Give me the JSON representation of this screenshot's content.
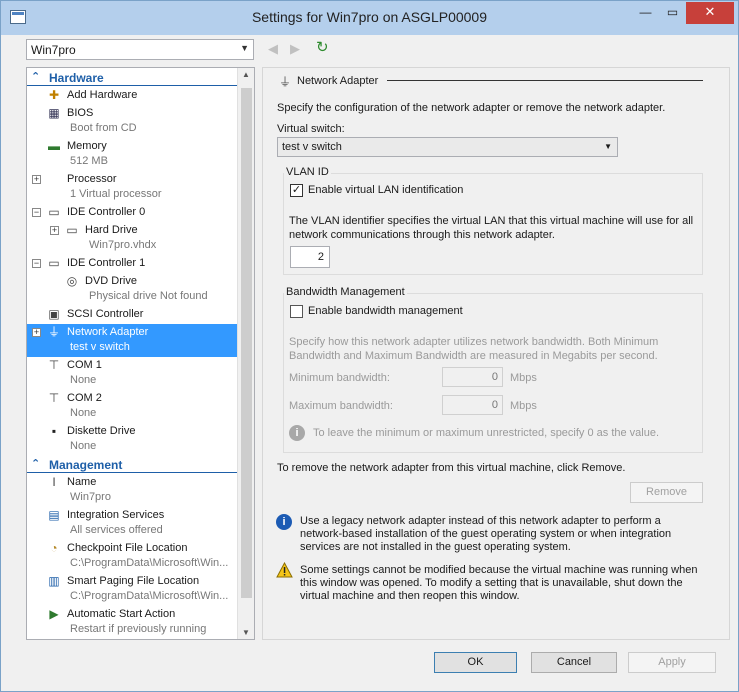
{
  "window": {
    "title": "Settings for Win7pro on ASGLP00009",
    "minimize": "—",
    "maximize": "▭",
    "close": "✕"
  },
  "vm_selector": {
    "value": "Win7pro"
  },
  "tree": {
    "hardware_label": "Hardware",
    "management_label": "Management",
    "hardware_items": [
      {
        "title": "Add Hardware",
        "subtitle": "",
        "icon": "add-hardware-icon"
      },
      {
        "title": "BIOS",
        "subtitle": "Boot from CD",
        "icon": "bios-icon"
      },
      {
        "title": "Memory",
        "subtitle": "512 MB",
        "icon": "memory-icon"
      },
      {
        "title": "Processor",
        "subtitle": "1 Virtual processor",
        "icon": "processor-icon"
      },
      {
        "title": "IDE Controller 0",
        "subtitle": "",
        "icon": "ide-controller-icon"
      },
      {
        "title": "Hard Drive",
        "subtitle": "Win7pro.vhdx",
        "icon": "hard-drive-icon"
      },
      {
        "title": "IDE Controller 1",
        "subtitle": "",
        "icon": "ide-controller-icon"
      },
      {
        "title": "DVD Drive",
        "subtitle": "Physical drive Not found",
        "icon": "dvd-drive-icon"
      },
      {
        "title": "SCSI Controller",
        "subtitle": "",
        "icon": "scsi-controller-icon"
      },
      {
        "title": "Network Adapter",
        "subtitle": "test v switch",
        "icon": "network-adapter-icon"
      },
      {
        "title": "COM 1",
        "subtitle": "None",
        "icon": "com-port-icon"
      },
      {
        "title": "COM 2",
        "subtitle": "None",
        "icon": "com-port-icon"
      },
      {
        "title": "Diskette Drive",
        "subtitle": "None",
        "icon": "diskette-icon"
      }
    ],
    "management_items": [
      {
        "title": "Name",
        "subtitle": "Win7pro",
        "icon": "name-icon"
      },
      {
        "title": "Integration Services",
        "subtitle": "All services offered",
        "icon": "integration-services-icon"
      },
      {
        "title": "Checkpoint File Location",
        "subtitle": "C:\\ProgramData\\Microsoft\\Win...",
        "icon": "checkpoint-icon"
      },
      {
        "title": "Smart Paging File Location",
        "subtitle": "C:\\ProgramData\\Microsoft\\Win...",
        "icon": "smart-paging-icon"
      },
      {
        "title": "Automatic Start Action",
        "subtitle": "Restart if previously running",
        "icon": "auto-start-icon"
      }
    ]
  },
  "panel": {
    "title": "Network Adapter",
    "description": "Specify the configuration of the network adapter or remove the network adapter.",
    "virtual_switch_label": "Virtual switch:",
    "virtual_switch_value": "test v switch",
    "vlan": {
      "group_label": "VLAN ID",
      "checkbox_label": "Enable virtual LAN identification",
      "checked": true,
      "description": "The VLAN identifier specifies the virtual LAN that this virtual machine will use for all network communications through this network adapter.",
      "value": "2"
    },
    "bandwidth": {
      "group_label": "Bandwidth Management",
      "checkbox_label": "Enable bandwidth management",
      "checked": false,
      "description": "Specify how this network adapter utilizes network bandwidth. Both Minimum Bandwidth and Maximum Bandwidth are measured in Megabits per second.",
      "min_label": "Minimum bandwidth:",
      "min_value": "0",
      "max_label": "Maximum bandwidth:",
      "max_value": "0",
      "unit": "Mbps",
      "hint": "To leave the minimum or maximum unrestricted, specify 0 as the value."
    },
    "remove_text": "To remove the network adapter from this virtual machine, click Remove.",
    "remove_button": "Remove",
    "info_text": "Use a legacy network adapter instead of this network adapter to perform a network-based installation of the guest operating system or when integration services are not installed in the guest operating system.",
    "warning_text": "Some settings cannot be modified because the virtual machine was running when this window was opened. To modify a setting that is unavailable, shut down the virtual machine and then reopen this window."
  },
  "footer": {
    "ok": "OK",
    "cancel": "Cancel",
    "apply": "Apply"
  }
}
